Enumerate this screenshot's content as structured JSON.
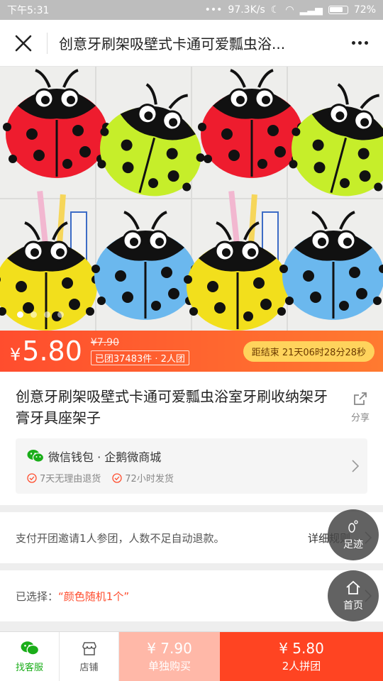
{
  "status_bar": {
    "time": "下午5:31",
    "network_speed": "97.3K/s",
    "battery": "72%"
  },
  "nav": {
    "title": "创意牙刷架吸壁式卡通可爱瓢虫浴..."
  },
  "gallery": {
    "image_description_icon": "ladybug-holders-image",
    "slide_count": 4,
    "active_slide": 1
  },
  "price_bar": {
    "currency": "¥",
    "price": "5.80",
    "original_price": "¥7.90",
    "group_info": "已团37483件 · 2人团",
    "countdown": "距结束 21天06时28分28秒"
  },
  "product": {
    "title": "创意牙刷架吸壁式卡通可爱瓢虫浴室牙刷收纳架牙膏牙具座架子",
    "share_label": "分享"
  },
  "shop": {
    "name": "微信钱包 · 企鹅微商城",
    "tags": [
      "7天无理由退货",
      "72小时发货"
    ]
  },
  "group_rule": {
    "text": "支付开团邀请1人参团，人数不足自动退款。",
    "link": "详细规则"
  },
  "selection": {
    "label": "已选择：",
    "value": "“颜色随机1个”"
  },
  "floating": {
    "footprint": "足迹",
    "home": "首页"
  },
  "bottom_bar": {
    "service": "找客服",
    "store": "店铺",
    "single_price": "¥ 7.90",
    "single_label": "单独购买",
    "group_price": "¥ 5.80",
    "group_label": "2人拼团"
  },
  "colors": {
    "accent": "#ff4d2e",
    "wechat_green": "#1aad19",
    "countdown_bg": "#ffd35c"
  }
}
